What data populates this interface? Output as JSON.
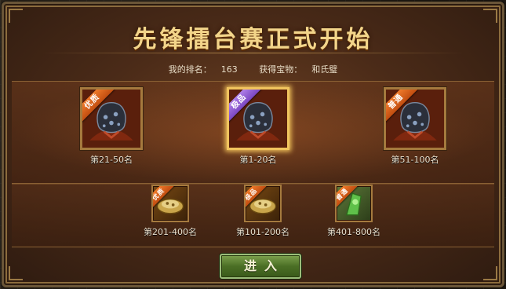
{
  "title": "先锋擂台赛正式开始",
  "info": {
    "rank_label": "我的排名：",
    "rank_value": "163",
    "treasure_label": "获得宝物：",
    "treasure_value": "和氏璧"
  },
  "top_rewards": [
    {
      "rank": "第21-50名",
      "badge": "优质",
      "badge_color": "#e0641e",
      "icon": "helmet-icon"
    },
    {
      "rank": "第1-20名",
      "badge": "极品",
      "badge_color": "#9b64d8",
      "icon": "helmet-icon",
      "selected": true
    },
    {
      "rank": "第51-100名",
      "badge": "普通",
      "badge_color": "#e0641e",
      "icon": "helmet-icon"
    }
  ],
  "bottom_rewards": [
    {
      "rank": "第201-400名",
      "badge": "优质",
      "badge_color": "#e0641e",
      "icon": "treasure-dish-icon"
    },
    {
      "rank": "第101-200名",
      "badge": "极品",
      "badge_color": "#e0641e",
      "icon": "treasure-dish-icon"
    },
    {
      "rank": "第401-800名",
      "badge": "普通",
      "badge_color": "#e0641e",
      "icon": "jade-token-icon"
    }
  ],
  "enter_button": "进入"
}
